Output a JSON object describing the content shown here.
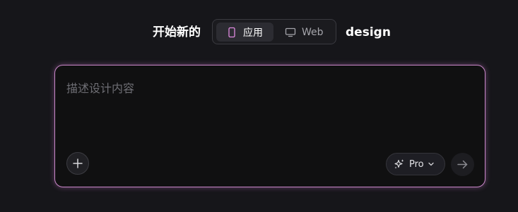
{
  "header": {
    "prefix": "开始新的",
    "suffix": "design",
    "toggle": {
      "options": [
        {
          "label": "应用",
          "icon": "mobile-phone-icon",
          "selected": true
        },
        {
          "label": "Web",
          "icon": "desktop-monitor-icon",
          "selected": false
        }
      ]
    }
  },
  "prompt": {
    "placeholder": "描述设计内容",
    "value": ""
  },
  "toolbar": {
    "add_icon": "plus-icon",
    "model_label": "Pro",
    "model_icon": "sparkles-icon",
    "send_icon": "arrow-right-icon"
  },
  "colors": {
    "background": "#16161a",
    "card_background": "#101011",
    "card_border": "#c987c9",
    "accent_icon": "#e08ae0"
  }
}
